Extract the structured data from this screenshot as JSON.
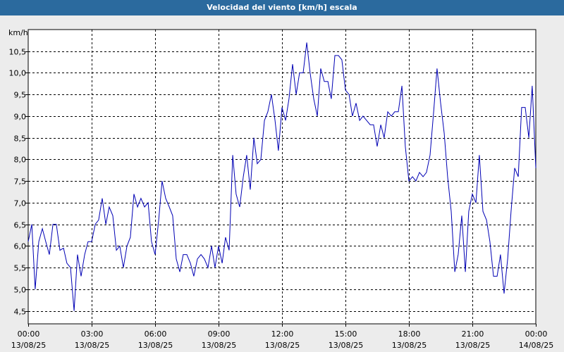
{
  "window": {
    "title": "Velocidad del viento [km/h] escala"
  },
  "chart_data": {
    "type": "line",
    "title": "Velocidad del viento [km/h] escala",
    "ylabel": "km/h",
    "ylim": [
      4.2,
      11.0
    ],
    "xlim": [
      0,
      24
    ],
    "grid": true,
    "line_color": "#0000b4",
    "background": "#ffffff",
    "y_ticks": [
      "4,5",
      "5,0",
      "5,5",
      "6,0",
      "6,5",
      "7,0",
      "7,5",
      "8,0",
      "8,5",
      "9,0",
      "9,5",
      "10,0",
      "10,5"
    ],
    "y_tick_values": [
      4.5,
      5.0,
      5.5,
      6.0,
      6.5,
      7.0,
      7.5,
      8.0,
      8.5,
      9.0,
      9.5,
      10.0,
      10.5
    ],
    "x_ticks": [
      {
        "hour": 0,
        "time": "00:00",
        "date": "13/08/25"
      },
      {
        "hour": 3,
        "time": "03:00",
        "date": "13/08/25"
      },
      {
        "hour": 6,
        "time": "06:00",
        "date": "13/08/25"
      },
      {
        "hour": 9,
        "time": "09:00",
        "date": "13/08/25"
      },
      {
        "hour": 12,
        "time": "12:00",
        "date": "13/08/25"
      },
      {
        "hour": 15,
        "time": "15:00",
        "date": "13/08/25"
      },
      {
        "hour": 18,
        "time": "18:00",
        "date": "13/08/25"
      },
      {
        "hour": 21,
        "time": "21:00",
        "date": "13/08/25"
      },
      {
        "hour": 24,
        "time": "00:00",
        "date": "14/08/25"
      }
    ],
    "series": [
      {
        "points": [
          [
            0.0,
            6.1
          ],
          [
            0.17,
            6.5
          ],
          [
            0.33,
            5.0
          ],
          [
            0.5,
            6.1
          ],
          [
            0.67,
            6.4
          ],
          [
            0.83,
            6.1
          ],
          [
            1.0,
            5.8
          ],
          [
            1.17,
            6.5
          ],
          [
            1.33,
            6.5
          ],
          [
            1.5,
            5.9
          ],
          [
            1.67,
            5.95
          ],
          [
            1.83,
            5.6
          ],
          [
            2.0,
            5.5
          ],
          [
            2.17,
            4.5
          ],
          [
            2.33,
            5.8
          ],
          [
            2.5,
            5.3
          ],
          [
            2.67,
            5.8
          ],
          [
            2.83,
            6.1
          ],
          [
            3.0,
            6.1
          ],
          [
            3.17,
            6.5
          ],
          [
            3.33,
            6.6
          ],
          [
            3.5,
            7.1
          ],
          [
            3.67,
            6.5
          ],
          [
            3.83,
            6.9
          ],
          [
            4.0,
            6.7
          ],
          [
            4.17,
            5.9
          ],
          [
            4.33,
            6.0
          ],
          [
            4.5,
            5.5
          ],
          [
            4.67,
            6.0
          ],
          [
            4.83,
            6.2
          ],
          [
            5.0,
            7.2
          ],
          [
            5.17,
            6.9
          ],
          [
            5.33,
            7.1
          ],
          [
            5.5,
            6.9
          ],
          [
            5.67,
            7.0
          ],
          [
            5.83,
            6.1
          ],
          [
            6.0,
            5.8
          ],
          [
            6.17,
            6.6
          ],
          [
            6.33,
            7.5
          ],
          [
            6.5,
            7.1
          ],
          [
            6.67,
            6.9
          ],
          [
            6.83,
            6.7
          ],
          [
            7.0,
            5.7
          ],
          [
            7.17,
            5.4
          ],
          [
            7.33,
            5.8
          ],
          [
            7.5,
            5.8
          ],
          [
            7.67,
            5.6
          ],
          [
            7.83,
            5.3
          ],
          [
            8.0,
            5.7
          ],
          [
            8.17,
            5.8
          ],
          [
            8.33,
            5.7
          ],
          [
            8.5,
            5.5
          ],
          [
            8.67,
            6.0
          ],
          [
            8.83,
            5.5
          ],
          [
            9.0,
            6.0
          ],
          [
            9.17,
            5.6
          ],
          [
            9.33,
            6.2
          ],
          [
            9.5,
            5.9
          ],
          [
            9.67,
            8.1
          ],
          [
            9.83,
            7.2
          ],
          [
            10.0,
            6.9
          ],
          [
            10.17,
            7.6
          ],
          [
            10.33,
            8.1
          ],
          [
            10.5,
            7.3
          ],
          [
            10.67,
            8.5
          ],
          [
            10.83,
            7.9
          ],
          [
            11.0,
            8.0
          ],
          [
            11.17,
            8.9
          ],
          [
            11.33,
            9.1
          ],
          [
            11.5,
            9.5
          ],
          [
            11.67,
            8.9
          ],
          [
            11.83,
            8.2
          ],
          [
            12.0,
            9.2
          ],
          [
            12.17,
            8.9
          ],
          [
            12.33,
            9.4
          ],
          [
            12.5,
            10.2
          ],
          [
            12.67,
            9.5
          ],
          [
            12.83,
            10.0
          ],
          [
            13.0,
            10.0
          ],
          [
            13.17,
            10.7
          ],
          [
            13.33,
            10.0
          ],
          [
            13.5,
            9.4
          ],
          [
            13.67,
            9.0
          ],
          [
            13.83,
            10.1
          ],
          [
            14.0,
            9.8
          ],
          [
            14.17,
            9.8
          ],
          [
            14.33,
            9.4
          ],
          [
            14.5,
            10.4
          ],
          [
            14.67,
            10.4
          ],
          [
            14.83,
            10.3
          ],
          [
            15.0,
            9.6
          ],
          [
            15.17,
            9.5
          ],
          [
            15.33,
            9.0
          ],
          [
            15.5,
            9.3
          ],
          [
            15.67,
            8.9
          ],
          [
            15.83,
            9.0
          ],
          [
            16.0,
            8.9
          ],
          [
            16.17,
            8.8
          ],
          [
            16.33,
            8.8
          ],
          [
            16.5,
            8.3
          ],
          [
            16.67,
            8.8
          ],
          [
            16.83,
            8.5
          ],
          [
            17.0,
            9.1
          ],
          [
            17.17,
            9.0
          ],
          [
            17.33,
            9.1
          ],
          [
            17.5,
            9.1
          ],
          [
            17.67,
            9.7
          ],
          [
            17.83,
            8.3
          ],
          [
            18.0,
            7.5
          ],
          [
            18.17,
            7.6
          ],
          [
            18.33,
            7.5
          ],
          [
            18.5,
            7.7
          ],
          [
            18.67,
            7.6
          ],
          [
            18.83,
            7.7
          ],
          [
            19.0,
            8.1
          ],
          [
            19.17,
            9.1
          ],
          [
            19.33,
            10.1
          ],
          [
            19.5,
            9.3
          ],
          [
            19.67,
            8.6
          ],
          [
            19.83,
            7.6
          ],
          [
            20.0,
            6.8
          ],
          [
            20.17,
            5.4
          ],
          [
            20.33,
            5.8
          ],
          [
            20.5,
            6.7
          ],
          [
            20.67,
            5.4
          ],
          [
            20.83,
            6.8
          ],
          [
            21.0,
            7.2
          ],
          [
            21.17,
            7.0
          ],
          [
            21.33,
            8.1
          ],
          [
            21.5,
            6.8
          ],
          [
            21.67,
            6.6
          ],
          [
            21.83,
            6.1
          ],
          [
            22.0,
            5.3
          ],
          [
            22.17,
            5.3
          ],
          [
            22.33,
            5.8
          ],
          [
            22.5,
            4.9
          ],
          [
            22.67,
            5.7
          ],
          [
            22.83,
            6.8
          ],
          [
            23.0,
            7.8
          ],
          [
            23.17,
            7.6
          ],
          [
            23.33,
            9.2
          ],
          [
            23.5,
            9.2
          ],
          [
            23.67,
            8.5
          ],
          [
            23.83,
            9.7
          ],
          [
            24.0,
            7.8
          ]
        ]
      }
    ]
  }
}
